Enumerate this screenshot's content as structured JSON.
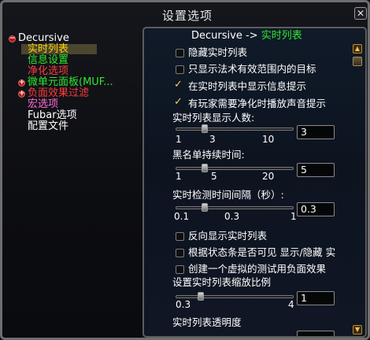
{
  "window": {
    "title": "设置选项",
    "close_glyph": "✕"
  },
  "colors": {
    "selected_text": "#ffd200",
    "green_text": "#2ee82e",
    "red_text": "#ff3b3b",
    "pink_text": "#ff6ad8",
    "white_text": "#ffffff"
  },
  "tree": {
    "items": [
      {
        "label": "Decursive",
        "color": "#ffffff",
        "expandable": true,
        "expanded": true
      },
      {
        "label": "实时列表",
        "color": "#ffd200",
        "selected": true
      },
      {
        "label": "信息设置",
        "color": "#2ee82e"
      },
      {
        "label": "净化选项",
        "color": "#ff3b3b"
      },
      {
        "label": "微单元面板(MUF...",
        "color": "#2ee82e",
        "expandable": true
      },
      {
        "label": "负面效果过滤",
        "color": "#ff3b3b",
        "expandable": true
      },
      {
        "label": "宏选项",
        "color": "#ff6ad8"
      },
      {
        "label": "Fubar选项",
        "color": "#ffffff"
      },
      {
        "label": "配置文件",
        "color": "#ffffff"
      }
    ]
  },
  "panel": {
    "breadcrumb_root": "Decursive ->",
    "breadcrumb_current": "实时列表",
    "options": {
      "hide_live_list": {
        "label": "隐藏实时列表",
        "checked": false
      },
      "only_in_range": {
        "label": "只显示法术有效范围内的目标",
        "checked": false
      },
      "show_info_tip": {
        "label": "在实时列表中显示信息提示",
        "checked": true
      },
      "play_sound": {
        "label": "有玩家需要净化时播放声音提示",
        "checked": true
      },
      "reverse_list": {
        "label": "反向显示实时列表",
        "checked": false
      },
      "status_bar_visible": {
        "label": "根据状态条是否可见 显示/隐藏 实",
        "checked": false
      },
      "virtual_debuff": {
        "label": "创建一个虚拟的测试用负面效果",
        "checked": false
      }
    },
    "sliders": {
      "display_count": {
        "label": "实时列表显示人数:",
        "min": "1",
        "mid": "3",
        "max": "10",
        "value": "3",
        "fraction": 0.22
      },
      "blacklist_time": {
        "label": "黑名单持续时间:",
        "min": "1",
        "mid": "5",
        "max": "20",
        "value": "5",
        "fraction": 0.21
      },
      "check_interval": {
        "label": "实时检测时间间隔（秒）:",
        "min": "0.1",
        "mid": "0.3",
        "max": "1",
        "value": "0.3",
        "fraction": 0.22
      },
      "scale": {
        "label": "设置实时列表缩放比例",
        "min": "0.3",
        "max": "4",
        "value": "1",
        "fraction": 0.19
      },
      "opacity": {
        "label": "实时列表透明度"
      }
    }
  }
}
